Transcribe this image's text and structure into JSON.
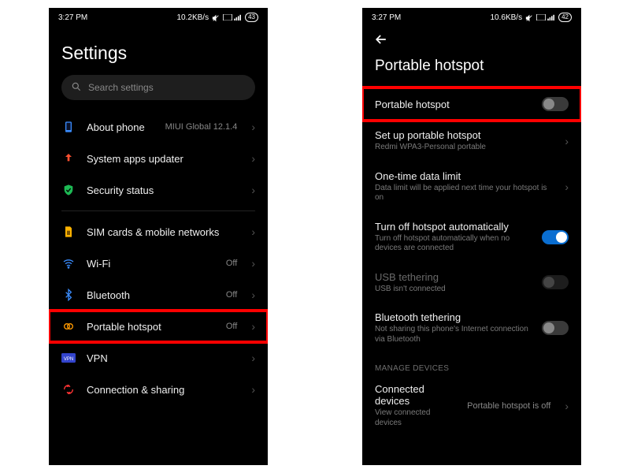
{
  "left": {
    "status": {
      "time": "3:27 PM",
      "speed": "10.2KB/s",
      "battery": "43"
    },
    "title": "Settings",
    "search_placeholder": "Search settings",
    "items": {
      "about": {
        "label": "About phone",
        "value": "MIUI Global 12.1.4"
      },
      "updater": {
        "label": "System apps updater"
      },
      "security": {
        "label": "Security status"
      },
      "sim": {
        "label": "SIM cards & mobile networks"
      },
      "wifi": {
        "label": "Wi-Fi",
        "value": "Off"
      },
      "bluetooth": {
        "label": "Bluetooth",
        "value": "Off"
      },
      "hotspot": {
        "label": "Portable hotspot",
        "value": "Off"
      },
      "vpn": {
        "label": "VPN"
      },
      "connshare": {
        "label": "Connection & sharing"
      }
    }
  },
  "right": {
    "status": {
      "time": "3:27 PM",
      "speed": "10.6KB/s",
      "battery": "42"
    },
    "title": "Portable hotspot",
    "items": {
      "hotspot": {
        "label": "Portable hotspot"
      },
      "setup": {
        "label": "Set up portable hotspot",
        "sub": "Redmi WPA3-Personal portable"
      },
      "limit": {
        "label": "One-time data limit",
        "sub": "Data limit will be applied next time your hotspot is on"
      },
      "autooff": {
        "label": "Turn off hotspot automatically",
        "sub": "Turn off hotspot automatically when no devices are connected"
      },
      "usb": {
        "label": "USB tethering",
        "sub": "USB isn't connected"
      },
      "bt": {
        "label": "Bluetooth tethering",
        "sub": "Not sharing this phone's Internet connection via Bluetooth"
      },
      "section": "MANAGE DEVICES",
      "connected": {
        "label": "Connected devices",
        "sub": "View connected devices",
        "value": "Portable hotspot is off"
      }
    }
  }
}
